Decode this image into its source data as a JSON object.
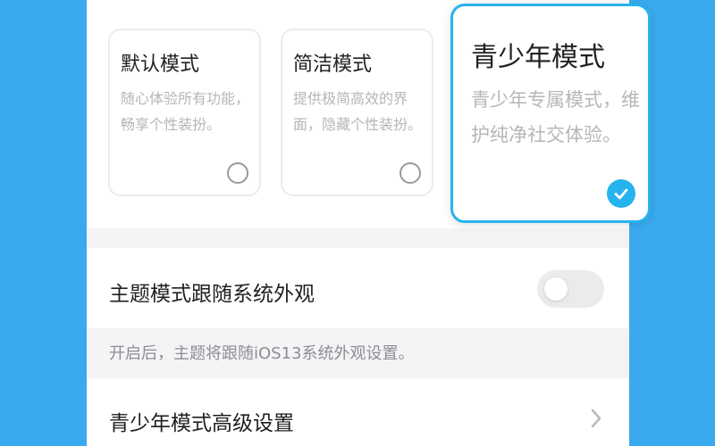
{
  "modes": [
    {
      "title": "默认模式",
      "description": "随心体验所有功能，畅享个性装扮。",
      "selected": false
    },
    {
      "title": "简洁模式",
      "description": "提供极简高效的界面，隐藏个性装扮。",
      "selected": false
    },
    {
      "title": "青少年模式",
      "description": "青少年专属模式，维护纯净社交体验。",
      "selected": true
    }
  ],
  "theme_follow": {
    "label": "主题模式跟随系统外观",
    "enabled": false,
    "note": "开启后，主题将跟随iOS13系统外观设置。"
  },
  "advanced": {
    "label": "青少年模式高级设置"
  },
  "colors": {
    "background": "#3aa9ee",
    "accent": "#27b3ee",
    "toggle_off": "#ebebed"
  },
  "icons": {
    "selected": "check-icon",
    "unselected": "radio-circle-icon",
    "navigate": "chevron-right-icon"
  }
}
